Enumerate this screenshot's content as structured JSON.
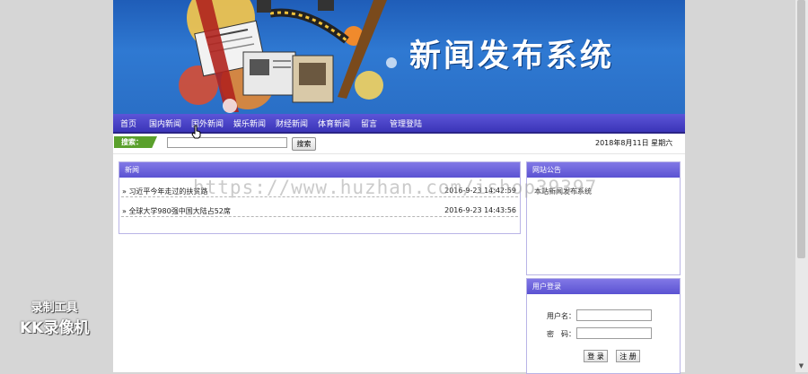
{
  "banner": {
    "title": "新闻发布系统"
  },
  "nav": {
    "items": [
      "首页",
      "国内新闻",
      "国外新闻",
      "娱乐新闻",
      "财经新闻",
      "体育新闻",
      "留言",
      "管理登陆"
    ]
  },
  "search": {
    "label": "搜索：",
    "button": "搜索",
    "value": "",
    "placeholder": ""
  },
  "date": "2018年8月11日 星期六",
  "news": {
    "title": "新闻",
    "rows": [
      {
        "title": "» 习近平今年走过的扶贫路",
        "date": "2016-9-23 14:42:59"
      },
      {
        "title": "» 全球大学980强中国大陆占52席",
        "date": "2016-9-23 14:43:56"
      }
    ]
  },
  "notice": {
    "title": "网站公告",
    "text": "本站新闻发布系统"
  },
  "login": {
    "title": "用户登录",
    "username_label": "用户名：",
    "password_label": "密　码：",
    "login_button": "登 录",
    "register_button": "注 册"
  },
  "overlay": {
    "watermark": "https://www.huzhan.com/ishop39397",
    "recorder_line1": "录制工具",
    "recorder_line2": "KK录像机"
  },
  "colors": {
    "nav": "#3b35b8",
    "panel_header": "#6a62dc",
    "banner": "#2a6fc6",
    "search_label": "#5aa02c"
  }
}
